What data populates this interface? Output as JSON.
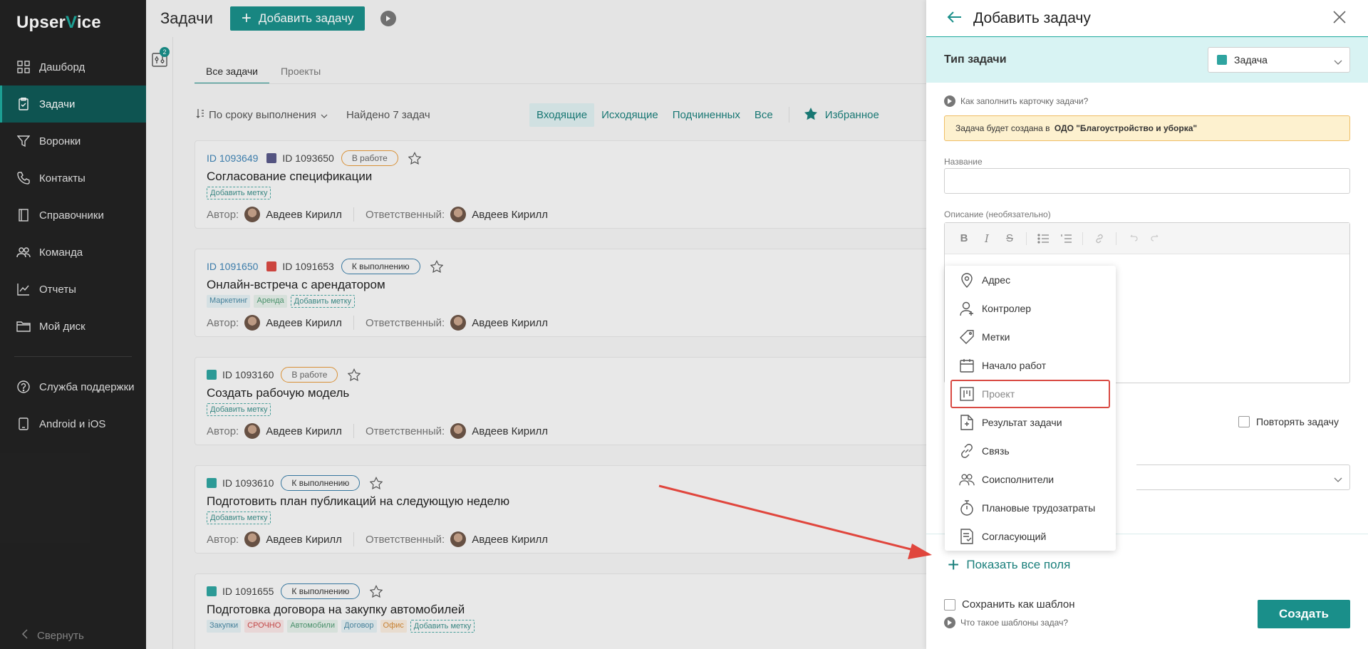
{
  "sidebar": {
    "logo_a": "Upser",
    "logo_v": "V",
    "logo_b": "ice",
    "items": [
      {
        "label": "Дашборд",
        "icon": "dashboard-icon"
      },
      {
        "label": "Задачи",
        "icon": "tasks-icon",
        "active": true
      },
      {
        "label": "Воронки",
        "icon": "funnel-icon"
      },
      {
        "label": "Контакты",
        "icon": "phone-icon"
      },
      {
        "label": "Справочники",
        "icon": "book-icon"
      },
      {
        "label": "Команда",
        "icon": "team-icon"
      },
      {
        "label": "Отчеты",
        "icon": "chart-icon"
      },
      {
        "label": "Мой диск",
        "icon": "folder-icon"
      }
    ],
    "support": "Служба поддержки",
    "mobile": "Android и iOS",
    "collapse": "Свернуть"
  },
  "header": {
    "title": "Задачи",
    "add_label": "Добавить задачу"
  },
  "filter_badge": "2",
  "tabs": [
    "Все задачи",
    "Проекты"
  ],
  "filterbar": {
    "sort": "По сроку выполнения",
    "found": "Найдено 7 задач",
    "tabs": [
      "Входящие",
      "Исходящие",
      "Подчиненных",
      "Все"
    ],
    "favorites": "Избранное"
  },
  "labels": {
    "author": "Автор:",
    "responsible": "Ответственный:",
    "add_tag": "Добавить метку"
  },
  "cards": [
    {
      "id_link": "ID 1093649",
      "id": "ID 1093650",
      "status": "В работе",
      "title": "Согласование спецификации",
      "author": "Авдеев Кирилл",
      "resp": "Авдеев Кирилл",
      "tags": []
    },
    {
      "id_link": "ID 1091650",
      "id": "ID 1091653",
      "status": "К выполнению",
      "title": "Онлайн-встреча с арендатором",
      "author": "Авдеев Кирилл",
      "resp": "Авдеев Кирилл",
      "tags": [
        "Маркетинг",
        "Аренда"
      ]
    },
    {
      "id_link": "",
      "id": "ID 1093160",
      "status": "В работе",
      "title": "Создать рабочую модель",
      "author": "Авдеев Кирилл",
      "resp": "Авдеев Кирилл",
      "tags": []
    },
    {
      "id_link": "",
      "id": "ID 1093610",
      "status": "К выполнению",
      "title": "Подготовить план публикаций на следующую неделю",
      "author": "Авдеев Кирилл",
      "resp": "Авдеев Кирилл",
      "tags": []
    },
    {
      "id_link": "",
      "id": "ID 1091655",
      "status": "К выполнению",
      "title": "Подготовка договора на закупку автомобилей",
      "tags": [
        "Закупки",
        "СРОЧНО",
        "Автомобили",
        "Договор",
        "Офис"
      ]
    }
  ],
  "panel": {
    "title": "Добавить задачу",
    "type_label": "Тип задачи",
    "type_value": "Задача",
    "howto": "Как заполнить карточку задачи?",
    "notice_prefix": "Задача будет создана в ",
    "notice_org": "ОДО \"Благоустройство и уборка\"",
    "name_label": "Название",
    "name_value": "",
    "desc_label": "Описание (необязательно)",
    "repeat": "Повторять задачу",
    "show_all": "Показать все поля",
    "save_template": "Сохранить как шаблон",
    "what_templates": "Что такое шаблоны задач?",
    "create": "Создать"
  },
  "dropdown": {
    "items": [
      {
        "label": "Адрес",
        "icon": "location-pin-icon"
      },
      {
        "label": "Контролер",
        "icon": "user-add-icon"
      },
      {
        "label": "Метки",
        "icon": "tag-icon"
      },
      {
        "label": "Начало работ",
        "icon": "calendar-icon"
      },
      {
        "label": "Проект",
        "icon": "kanban-icon",
        "highlighted": true
      },
      {
        "label": "Результат задачи",
        "icon": "document-plus-icon"
      },
      {
        "label": "Связь",
        "icon": "link-icon"
      },
      {
        "label": "Соисполнители",
        "icon": "users-icon"
      },
      {
        "label": "Плановые трудозатраты",
        "icon": "stopwatch-icon"
      },
      {
        "label": "Согласующий",
        "icon": "approval-doc-icon"
      }
    ]
  },
  "colors": {
    "accent": "#1a8f8a",
    "sidebar_bg": "#232323",
    "highlight": "#d94a43"
  }
}
